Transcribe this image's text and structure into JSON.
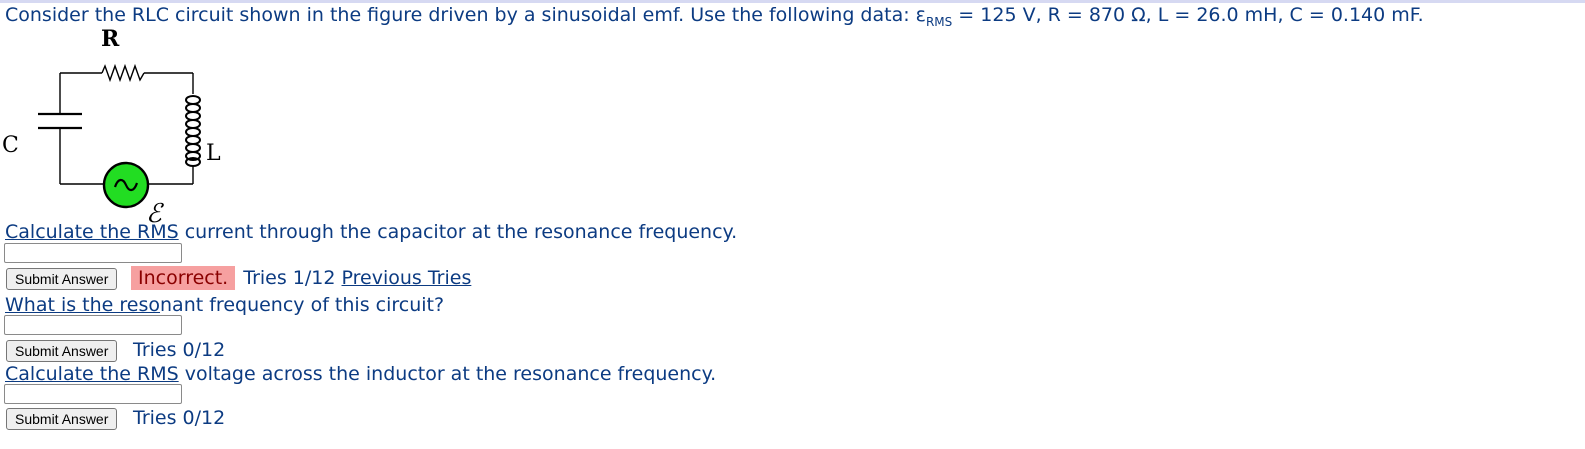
{
  "problem": {
    "statement_prefix": "Consider the RLC circuit shown in the figure driven by a sinusoidal emf. Use the following data: ε",
    "statement_sub": "RMS",
    "statement_suffix": " = 125 V, R = 870 Ω, L = 26.0 mH, C = 0.140 mF."
  },
  "figure": {
    "label_r": "R",
    "label_c": "C",
    "label_l": "L",
    "label_emf": "ℰ",
    "source_color": "#22dd22"
  },
  "questions": [
    {
      "pre": "Calculate the ",
      "link": "RMS",
      "post": " current through the capacitor at the resonance frequency.",
      "answer_value": "",
      "submit_label": "Submit Answer",
      "status": "Incorrect.",
      "tries": "Tries 1/12",
      "previous_tries": "Previous Tries"
    },
    {
      "pre": "",
      "link": "What is the reso",
      "post": "nant frequency of this circuit?",
      "answer_value": "",
      "submit_label": "Submit Answer",
      "tries": "Tries 0/12"
    },
    {
      "pre": "",
      "link": "Calculate the RMS",
      "post": " voltage across the inductor at the resonance frequency.",
      "answer_value": "",
      "submit_label": "Submit Answer",
      "tries": "Tries 0/12"
    }
  ],
  "colors": {
    "text": "#0c3b82",
    "incorrect_bg": "#f6a0a0",
    "incorrect_text": "#8a0000"
  }
}
